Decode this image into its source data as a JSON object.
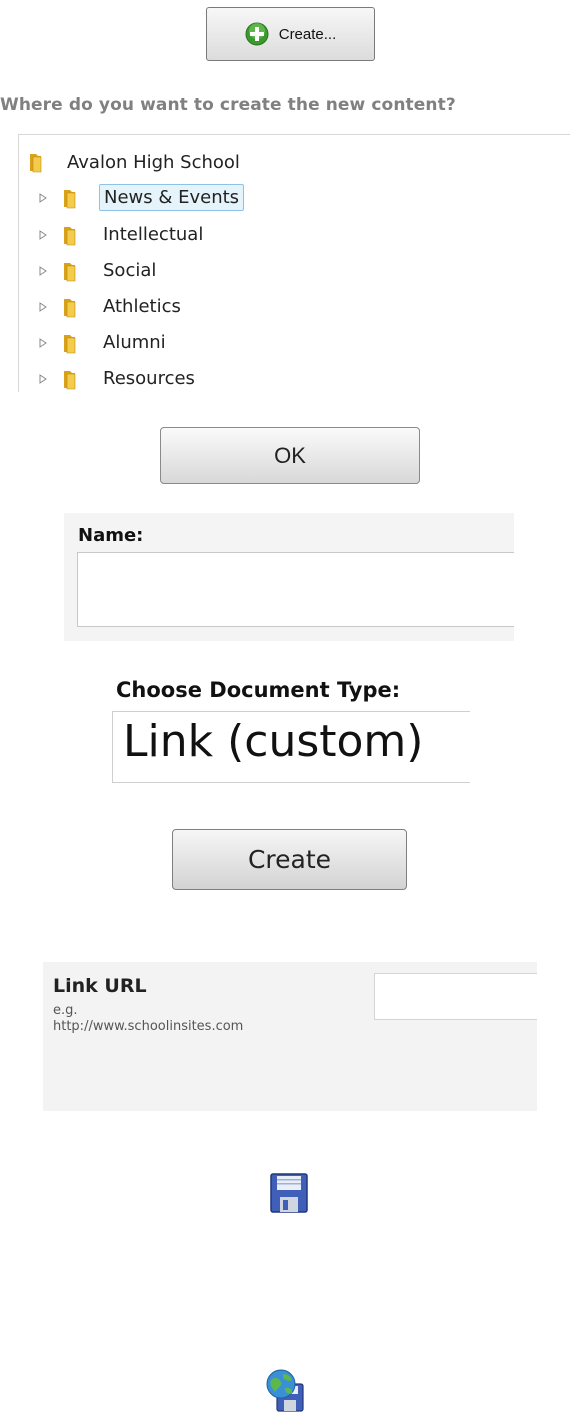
{
  "create_button": {
    "label": "Create...",
    "icon": "add-circle-icon",
    "icon_color": "#3b9a2e"
  },
  "question": "Where do you want to create the new content?",
  "tree": {
    "root": {
      "label": "Avalon High School",
      "icon": "folder-icon"
    },
    "items": [
      {
        "label": "News & Events",
        "selected": true
      },
      {
        "label": "Intellectual",
        "selected": false
      },
      {
        "label": "Social",
        "selected": false
      },
      {
        "label": "Athletics",
        "selected": false
      },
      {
        "label": "Alumni",
        "selected": false
      },
      {
        "label": "Resources",
        "selected": false
      }
    ],
    "selection_color": "#e5f3fb",
    "folder_color": "#e8b830"
  },
  "ok_button": {
    "label": "OK"
  },
  "name_field": {
    "label": "Name:",
    "value": ""
  },
  "document_type": {
    "label": "Choose Document Type:",
    "value": "Link (custom)"
  },
  "create_doc_button": {
    "label": "Create"
  },
  "link_url": {
    "label": "Link URL",
    "hint_line1": "e.g.",
    "hint_line2": "http://www.schoolinsites.com",
    "value": ""
  },
  "icons": {
    "save": "save-floppy-icon",
    "publish": "save-and-publish-globe-icon"
  }
}
